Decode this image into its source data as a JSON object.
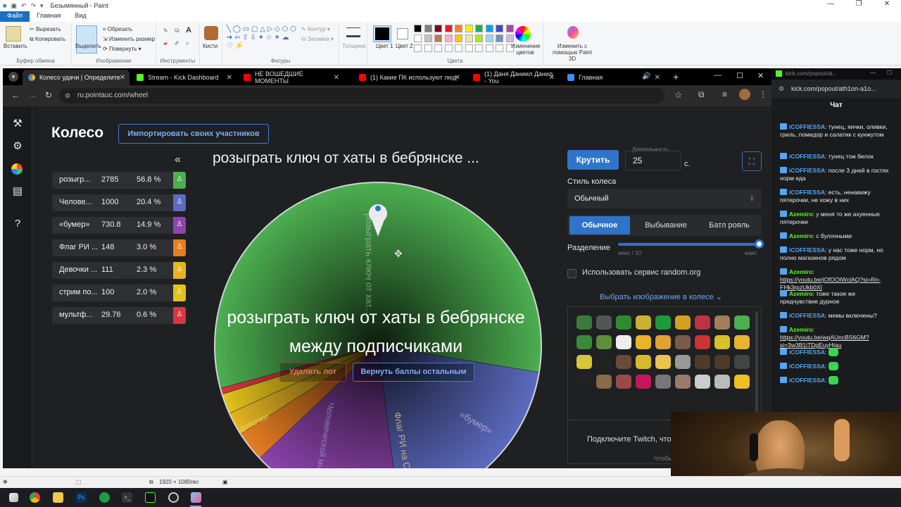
{
  "paint": {
    "title": "Безымянный - Paint",
    "tabs": [
      "Файл",
      "Главная",
      "Вид"
    ],
    "clipboard": {
      "paste": "Вставить",
      "cut": "Вырезать",
      "copy": "Копировать",
      "group": "Буфер обмена"
    },
    "image": {
      "select": "Выделить",
      "crop": "Обрезать",
      "resize": "Изменить размер",
      "rotate": "Повернуть",
      "group": "Изображение"
    },
    "tools": {
      "group": "Инструменты"
    },
    "brushes": "Кисти",
    "shapes": {
      "outline": "Контур",
      "fill": "Заливка",
      "group": "Фигуры"
    },
    "size": "Толщина",
    "color1": "Цвет 1",
    "color2": "Цвет 2",
    "colors_group": "Цвета",
    "edit_colors": "Изменение цветов",
    "paint3d": "Изменить с помощью Paint 3D",
    "status_size": "1920 × 1080пкс",
    "palette": [
      "#000000",
      "#7f7f7f",
      "#880015",
      "#ed1c24",
      "#ff7f27",
      "#fff200",
      "#22b14c",
      "#00a2e8",
      "#3f48cc",
      "#a349a4",
      "#ffffff",
      "#c3c3c3",
      "#b97a57",
      "#ffaec9",
      "#ffc90e",
      "#efe4b0",
      "#b5e61d",
      "#99d9ea",
      "#7092be",
      "#c8bfe7"
    ]
  },
  "browser": {
    "tabs": [
      {
        "label": "Колесо удачи | Определите",
        "color": "#3f8cff"
      },
      {
        "label": "Stream - Kick Dashboard",
        "color": "#53fc18"
      },
      {
        "label": "НЕ ВОШЕДШИЕ МОМЕНТЫ",
        "color": "#ff0000"
      },
      {
        "label": "(1) Какие ПК используют люд",
        "color": "#ff0000"
      },
      {
        "label": "(1) Даня Даниил Данил - You",
        "color": "#ff0000"
      },
      {
        "label": "Главная",
        "color": "#3f8cff"
      }
    ],
    "url": "ru.pointauc.com/wheel"
  },
  "wheel_page": {
    "title": "Колесо",
    "import_button": "Импортировать своих участников",
    "collapse": "«",
    "winner_top": "розыграть ключ от хаты в бебрянске ...",
    "winner_center": "розыграть ключ от хаты в бебрянске между подписчиками",
    "delete_button": "Удалить лот",
    "return_button": "Вернуть баллы остальным",
    "lots": [
      {
        "name": "розыгр...",
        "amount": "2785",
        "percent": "56.8 %",
        "color": "#4caf50"
      },
      {
        "name": "Челове...",
        "amount": "1000",
        "percent": "20.4 %",
        "color": "#5c6bc0"
      },
      {
        "name": "«бумер»",
        "amount": "730.8",
        "percent": "14.9 %",
        "color": "#8e44ad"
      },
      {
        "name": "Флаг РИ ...",
        "amount": "148",
        "percent": "3.0 %",
        "color": "#e67e22"
      },
      {
        "name": "Девочки ...",
        "amount": "111",
        "percent": "2.3 %",
        "color": "#e6b422"
      },
      {
        "name": "стрим по...",
        "amount": "100",
        "percent": "2.0 %",
        "color": "#e3c21a"
      },
      {
        "name": "мультф...",
        "amount": "29.76",
        "percent": "0.6 %",
        "color": "#d9363e"
      }
    ],
    "segment_labels": {
      "main": "розыграть ключ от хат...",
      "bumer": "«бумер»",
      "flag": "Флаг РИ на С",
      "human": "Человеческой много",
      "girls": "девочки"
    },
    "spin_button": "Крутить",
    "duration_label": "Длительность",
    "duration_value": "25",
    "duration_unit": "с.",
    "style_label": "Стиль колеса",
    "style_value": "Обычный",
    "modes": [
      "Обычное",
      "Выбывание",
      "Батл рояль"
    ],
    "split_label": "Разделение",
    "split_min": "макс / 10",
    "split_max": "макс",
    "split_value": 1.0,
    "random_org": "Использовать сервис random.org",
    "image_select": "Выбрать изображение в колесе",
    "twitch_text": "Подключите Twitch, чтобы больше изображен",
    "twitch_text2": "Чтобы"
  },
  "chat": {
    "popout_url": "kick.com/popout/at...",
    "url": "kick.com/popout/ath1on-a1o...",
    "title": "Чат",
    "messages": [
      {
        "user": "iCOFFIESSA",
        "color": "#53a6f3",
        "text": "тунец, яички, оливки, гриль, помидор и салатик с кунжутом"
      },
      {
        "user": "iCOFFIESSA",
        "color": "#53a6f3",
        "text": "тунец тож белок"
      },
      {
        "user": "iCOFFIESSA",
        "color": "#53a6f3",
        "text": "после 3 дней в гостях норм еда"
      },
      {
        "user": "iCOFFIESSA",
        "color": "#53a6f3",
        "text": "есть, ненавижу пятерочки, не хожу в них"
      },
      {
        "user": "Azemiro",
        "color": "#53fc18",
        "text": "у меня то же ахуенные пятерочки"
      },
      {
        "user": "Azemiro",
        "color": "#53fc18",
        "text": "с булочными"
      },
      {
        "user": "iCOFFIESSA",
        "color": "#53a6f3",
        "text": "у нас тоже норм, но полно магазинов рядом"
      },
      {
        "user": "Azemiro",
        "color": "#53fc18",
        "text": "",
        "link": "https://youtu.be/jOfOOIWclAQ?si=Rn-FHk3rpzUkb0XI"
      },
      {
        "user": "Azemiro",
        "color": "#53fc18",
        "text": "тоже такое же предчувствие дурное"
      },
      {
        "user": "iCOFFIESSA",
        "color": "#53a6f3",
        "text": "мемы включены?"
      },
      {
        "user": "Azemiro",
        "color": "#53fc18",
        "text": "",
        "link": "https://youtu.be/wqAUncBS6GM?si=3w3B1iTDgEuyHtau"
      },
      {
        "user": "iCOFFIESSA",
        "color": "#53a6f3",
        "text": ""
      },
      {
        "user": "iCOFFIESSA",
        "color": "#53a6f3",
        "text": ""
      },
      {
        "user": "iCOFFIESSA",
        "color": "#53a6f3",
        "text": ""
      }
    ]
  },
  "taskbar": {
    "icons": [
      "windows-icon",
      "chrome-icon",
      "explorer-icon",
      "photoshop-icon",
      "xbox-icon",
      "terminal-icon",
      "kick-icon",
      "obs-icon",
      "paint-icon"
    ]
  }
}
